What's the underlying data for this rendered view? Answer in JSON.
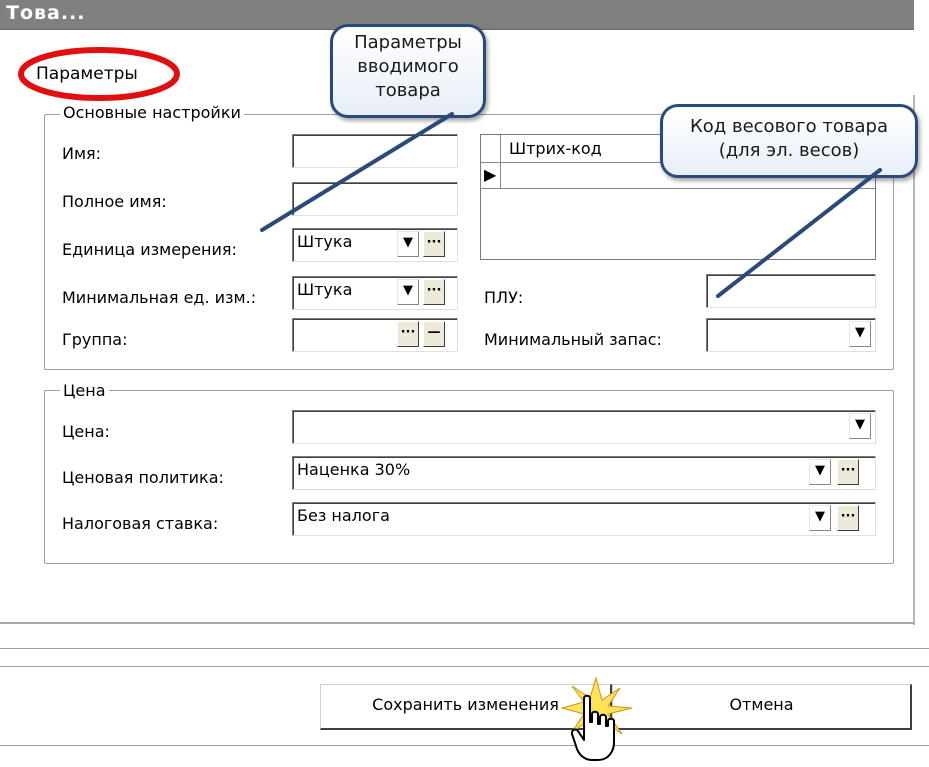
{
  "window": {
    "title": "Това..."
  },
  "tab": {
    "label": "Параметры"
  },
  "main_settings": {
    "legend": "Основные настройки",
    "name_label": "Имя:",
    "name_value": "",
    "full_name_label": "Полное имя:",
    "full_name_value": "",
    "unit_label": "Единица измерения:",
    "unit_value": "Штука",
    "min_unit_label": "Минимальная ед. изм.:",
    "min_unit_value": "Штука",
    "group_label": "Группа:",
    "group_value": "",
    "barcode_header": "Штрих-код",
    "plu_label": "ПЛУ:",
    "plu_value": "",
    "min_stock_label": "Минимальный запас:",
    "min_stock_value": ""
  },
  "price": {
    "legend": "Цена",
    "price_label": "Цена:",
    "price_value": "",
    "policy_label": "Ценовая политика:",
    "policy_value": "Наценка 30%",
    "tax_label": "Налоговая ставка:",
    "tax_value": "Без налога"
  },
  "buttons": {
    "save": "Сохранить изменения",
    "cancel": "Отмена"
  },
  "glyphs": {
    "ellipsis": "···",
    "dropdown": "▼",
    "minus": "—",
    "row_pointer": "▶"
  },
  "callouts": {
    "params_line1": "Параметры",
    "params_line2": "вводимого",
    "params_line3": "товара",
    "weight_line1": "Код весового товара",
    "weight_line2": "(для эл. весов)"
  },
  "colors": {
    "callout_border": "#2b4a7c",
    "highlight_ellipse": "#e01010",
    "titlebar": "#808080"
  }
}
